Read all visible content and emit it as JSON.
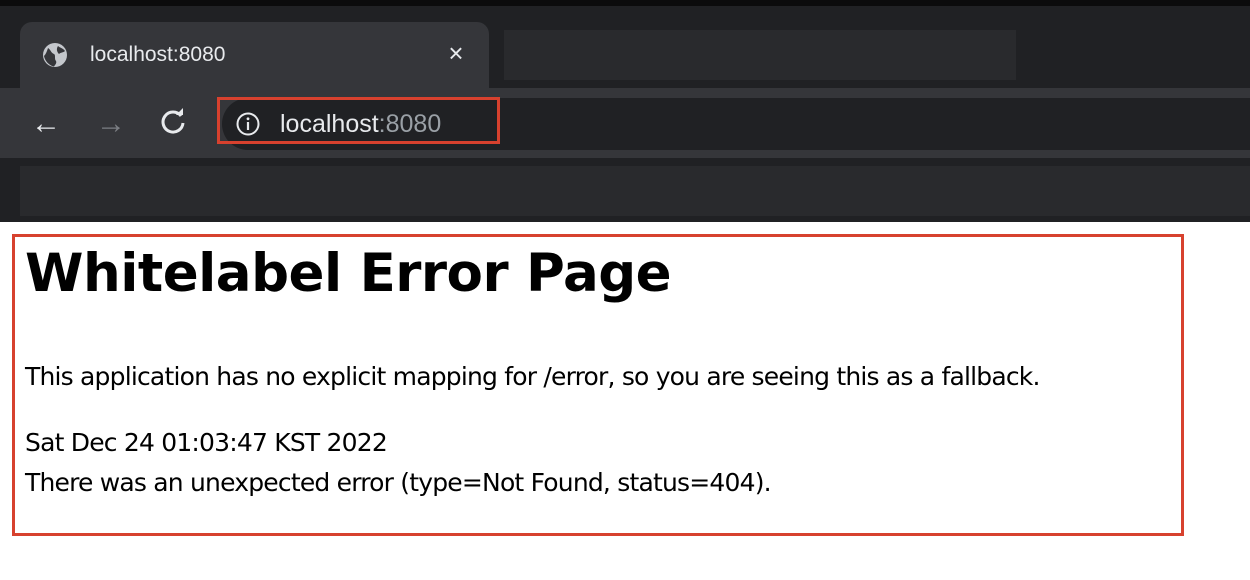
{
  "browser": {
    "tab": {
      "title": "localhost:8080",
      "close_glyph": "×",
      "icon": "globe-icon"
    },
    "nav": {
      "back_glyph": "←",
      "forward_glyph": "→",
      "reload_glyph": "C"
    },
    "omnibox": {
      "host": "localhost",
      "port": ":8080",
      "icon": "info-icon"
    },
    "colors": {
      "chrome_dark": "#202124",
      "highlight_border": "#d7412e"
    }
  },
  "page": {
    "heading": "Whitelabel Error Page",
    "message": "This application has no explicit mapping for /error, so you are seeing this as a fallback.",
    "timestamp": "Sat Dec 24 01:03:47 KST 2022",
    "error_detail": "There was an unexpected error (type=Not Found, status=404)."
  }
}
